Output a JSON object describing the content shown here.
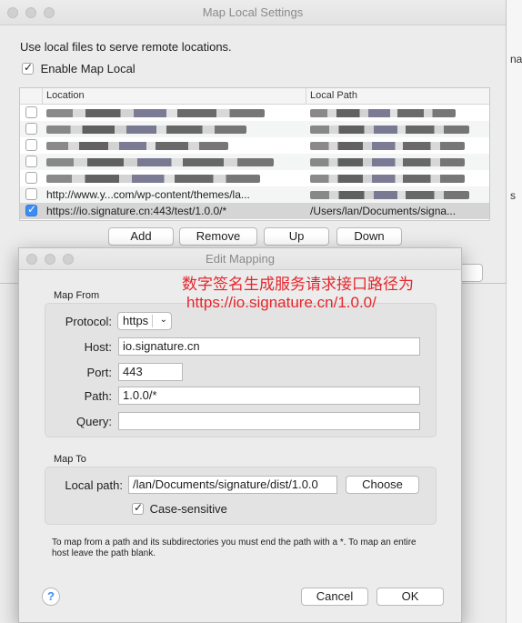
{
  "background": {
    "right_fragments": [
      "na",
      "s"
    ]
  },
  "map_local_window": {
    "title": "Map Local Settings",
    "intro": "Use local files to serve remote locations.",
    "enable_label": "Enable Map Local",
    "enable_checked": true,
    "columns": {
      "location": "Location",
      "local_path": "Local Path"
    },
    "rows": [
      {
        "checked": false,
        "location": "",
        "local_path": "",
        "blurred": true
      },
      {
        "checked": false,
        "location": "",
        "local_path": "",
        "blurred": true
      },
      {
        "checked": false,
        "location": "",
        "local_path": "",
        "blurred": true
      },
      {
        "checked": false,
        "location": "",
        "local_path": "",
        "blurred": true
      },
      {
        "checked": false,
        "location": "",
        "local_path": "",
        "blurred": true
      },
      {
        "checked": false,
        "location": "http://www.y...com/wp-content/themes/la...",
        "local_path": "",
        "blurred": true
      },
      {
        "checked": true,
        "location": "https://io.signature.cn:443/test/1.0.0/*",
        "local_path": "/Users/lan/Documents/signa...",
        "blurred": false
      }
    ],
    "buttons": {
      "add": "Add",
      "remove": "Remove",
      "up": "Up",
      "down": "Down"
    }
  },
  "annotation": {
    "line1": "数字签名生成服务请求接口路径为",
    "line2": "https://io.signature.cn/1.0.0/",
    "color": "#e5262c"
  },
  "edit_mapping": {
    "title": "Edit Mapping",
    "map_from_label": "Map From",
    "protocol_label": "Protocol:",
    "protocol_value": "https",
    "host_label": "Host:",
    "host_value": "io.signature.cn",
    "port_label": "Port:",
    "port_value": "443",
    "path_label": "Path:",
    "path_value": "1.0.0/*",
    "query_label": "Query:",
    "query_value": "",
    "map_to_label": "Map To",
    "local_path_label": "Local path:",
    "local_path_value": "/lan/Documents/signature/dist/1.0.0",
    "choose_label": "Choose",
    "case_sensitive_label": "Case-sensitive",
    "case_sensitive_checked": true,
    "note": "To map from a path and its subdirectories you must end the path with a *. To map an entire host leave the path blank.",
    "help_label": "?",
    "cancel_label": "Cancel",
    "ok_label": "OK"
  }
}
